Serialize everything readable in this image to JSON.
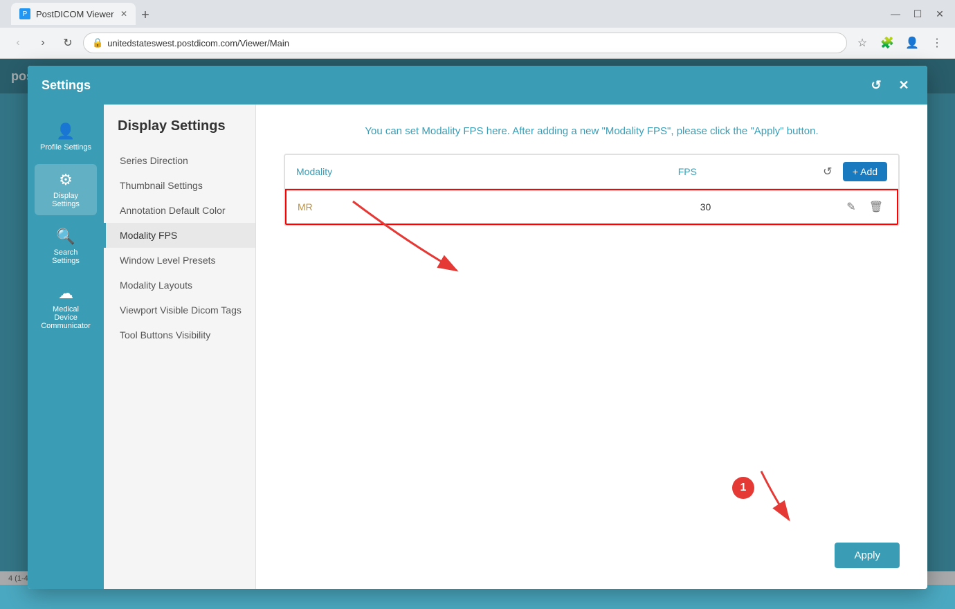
{
  "browser": {
    "tab_title": "PostDICOM Viewer",
    "new_tab_symbol": "+",
    "address": "unitedstateswest.postdicom.com/Viewer/Main",
    "nav": {
      "back": "‹",
      "forward": "›",
      "reload": "↻"
    }
  },
  "settings": {
    "title": "Settings",
    "close_icon": "✕",
    "reset_icon": "↺",
    "info_text": "You can set Modality FPS here. After adding a new \"Modality FPS\", please click the \"Apply\" button.",
    "sidebar": [
      {
        "id": "profile",
        "label": "Profile Settings",
        "icon": "👤"
      },
      {
        "id": "display",
        "label": "Display Settings",
        "icon": "⚙"
      },
      {
        "id": "search",
        "label": "Search Settings",
        "icon": "🔍"
      },
      {
        "id": "medical",
        "label": "Medical Device Communicator",
        "icon": "☁"
      }
    ],
    "sub_nav": {
      "title": "Display Settings",
      "items": [
        {
          "id": "series-direction",
          "label": "Series Direction"
        },
        {
          "id": "thumbnail-settings",
          "label": "Thumbnail Settings"
        },
        {
          "id": "annotation-default-color",
          "label": "Annotation Default Color"
        },
        {
          "id": "modality-fps",
          "label": "Modality FPS",
          "active": true
        },
        {
          "id": "window-level-presets",
          "label": "Window Level Presets"
        },
        {
          "id": "modality-layouts",
          "label": "Modality Layouts"
        },
        {
          "id": "viewport-visible-dicom-tags",
          "label": "Viewport Visible Dicom Tags"
        },
        {
          "id": "tool-buttons-visibility",
          "label": "Tool Buttons Visibility"
        }
      ]
    },
    "table": {
      "col_modality": "Modality",
      "col_fps": "FPS",
      "add_label": "+ Add",
      "rows": [
        {
          "modality": "MR",
          "fps": "30"
        }
      ]
    },
    "apply_label": "Apply"
  }
}
